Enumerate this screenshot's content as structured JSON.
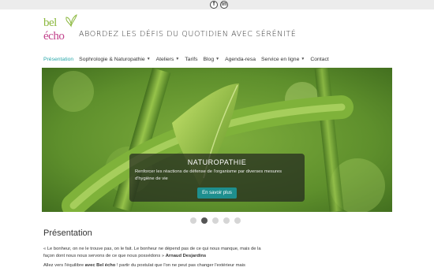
{
  "topbar": {
    "facebook_icon": "facebook-icon",
    "linkedin_icon": "linkedin-icon",
    "facebook_glyph": "f",
    "linkedin_glyph": "in"
  },
  "logo": {
    "line1": "bel",
    "line2": "écho",
    "colors": {
      "bel": "#8bb83e",
      "echo": "#c2428c"
    }
  },
  "tagline": "ABORDEZ LES DÉFIS DU QUOTIDIEN AVEC SÉRÉNITÉ",
  "nav": {
    "items": [
      {
        "label": "Présentation",
        "active": true,
        "dropdown": false
      },
      {
        "label": "Sophrologie & Naturopathie",
        "dropdown": true
      },
      {
        "label": "Ateliers",
        "dropdown": true
      },
      {
        "label": "Tarifs",
        "dropdown": false
      },
      {
        "label": "Blog",
        "dropdown": true
      },
      {
        "label": "Agenda-resa",
        "dropdown": false
      },
      {
        "label": "Service en ligne",
        "dropdown": true
      },
      {
        "label": "Contact",
        "dropdown": false
      }
    ],
    "accent_color": "#28a7a9"
  },
  "slider": {
    "title": "NATUROPATHIE",
    "text": "Renforcer les réactions de défense de l'organisme par diverses mesures d'hygiène de vie",
    "button": "En savoir plus",
    "dots": 5,
    "active_dot": 2
  },
  "section": {
    "title": "Présentation",
    "quote": "« Le bonheur, on ne le trouve pas, on le fait. Le bonheur ne dépend pas de ce qui nous manque, mais de la façon dont nous nous servons de ce que nous possédons »",
    "author": "Arnaud Desjardins",
    "p2_start": "Allez vers l'équilibre ",
    "p2_bold": "avec Bel écho",
    "p2_end": " ! partir du postulat que l'on ne peut pas changer l'extérieur mais"
  }
}
